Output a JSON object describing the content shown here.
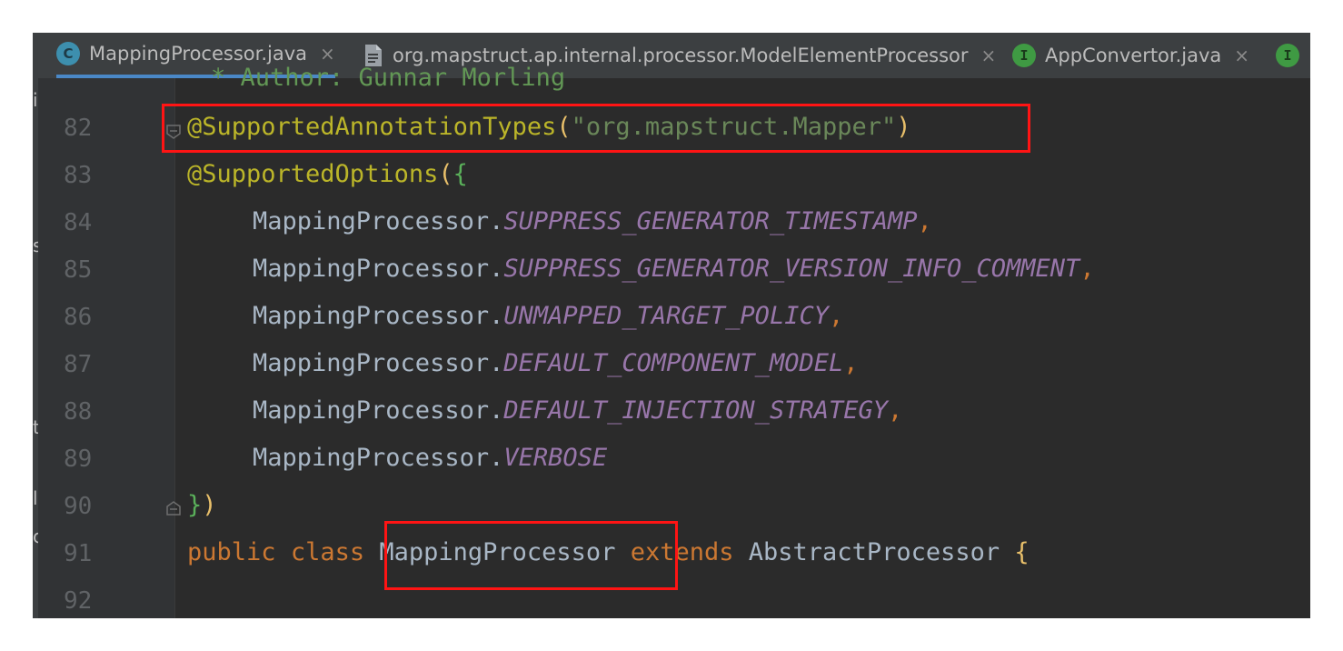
{
  "tabs": [
    {
      "label": "MappingProcessor.java",
      "icon": "class-c-icon",
      "close": "×",
      "active": true
    },
    {
      "label": "org.mapstruct.ap.internal.processor.ModelElementProcessor",
      "icon": "file-icon",
      "close": "×",
      "active": false
    },
    {
      "label": "AppConvertor.java",
      "icon": "interface-i-icon",
      "close": "×",
      "active": false
    }
  ],
  "icon_letters": {
    "class": "C",
    "interface": "I"
  },
  "left_edge_glyphs": [
    "i",
    "s",
    "t",
    "l",
    "c"
  ],
  "editor": {
    "partial_comment": "* Author: Gunnar Morling",
    "line_numbers": [
      "82",
      "83",
      "84",
      "85",
      "86",
      "87",
      "88",
      "89",
      "90",
      "91",
      "92"
    ],
    "lines": {
      "l82": {
        "annotation": "@SupportedAnnotationTypes",
        "open": "(",
        "string": "\"org.mapstruct.Mapper\"",
        "close": ")"
      },
      "l83": {
        "annotation": "@SupportedOptions",
        "open": "(",
        "brace": "{"
      },
      "l84": {
        "cls": "MappingProcessor.",
        "constant": "SUPPRESS_GENERATOR_TIMESTAMP",
        "comma": ","
      },
      "l85": {
        "cls": "MappingProcessor.",
        "constant": "SUPPRESS_GENERATOR_VERSION_INFO_COMMENT",
        "comma": ","
      },
      "l86": {
        "cls": "MappingProcessor.",
        "constant": "UNMAPPED_TARGET_POLICY",
        "comma": ","
      },
      "l87": {
        "cls": "MappingProcessor.",
        "constant": "DEFAULT_COMPONENT_MODEL",
        "comma": ","
      },
      "l88": {
        "cls": "MappingProcessor.",
        "constant": "DEFAULT_INJECTION_STRATEGY",
        "comma": ","
      },
      "l89": {
        "cls": "MappingProcessor.",
        "constant": "VERBOSE"
      },
      "l90": {
        "brace": "}",
        "close": ")"
      },
      "l91": {
        "kw1": "public",
        "kw2": "class",
        "name": "MappingProcessor",
        "kw3": "extends",
        "parent": "AbstractProcessor",
        "brace": "{"
      }
    }
  },
  "colors": {
    "annotation": "#bbb529",
    "string": "#6a8759",
    "constant": "#9876aa",
    "keyword": "#cc7832",
    "highlight_box": "#ff1414"
  }
}
